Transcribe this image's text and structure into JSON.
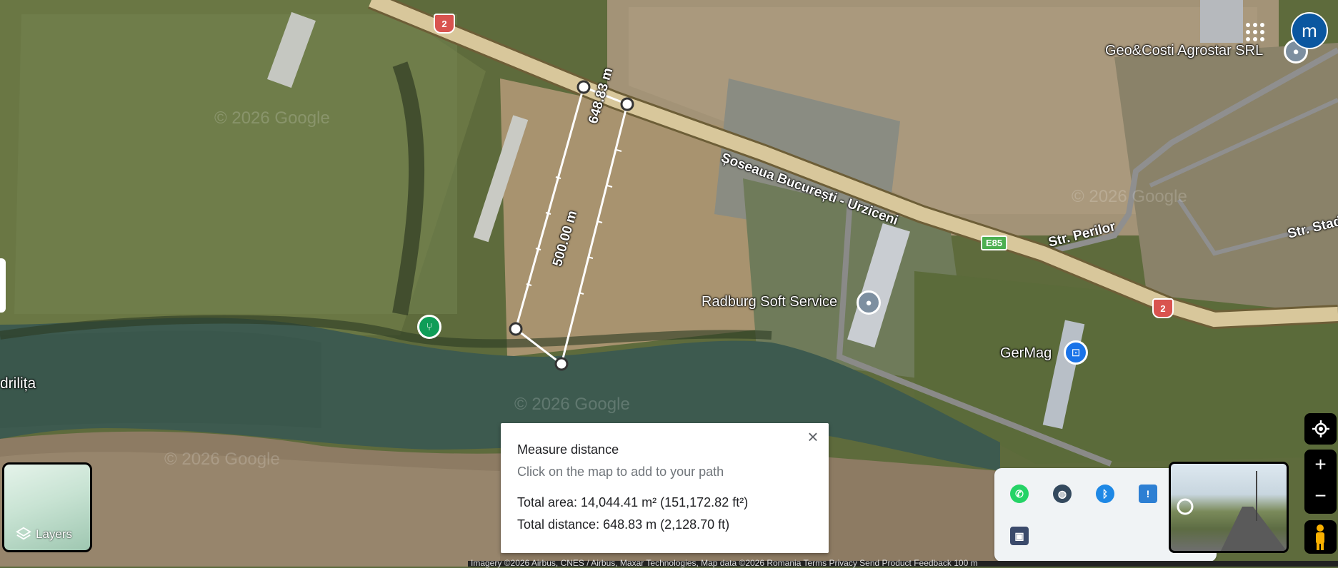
{
  "map": {
    "roads": {
      "main_road": "Șoseaua București - Urziceni",
      "perilor": "Str. Perilor",
      "stad": "Str. Stad",
      "route_shield": "2",
      "e_route": "E85"
    },
    "places": {
      "geocosti": "Geo&Costi Agrostar SRL",
      "radburg": "Radburg Soft Service",
      "germag": "GerMag",
      "lake": "drilița"
    },
    "watermarks": [
      "© 2026 Google",
      "© 2026 Google",
      "© 2026 Google",
      "© 2026 Google"
    ],
    "measure_labels": {
      "segment_top": "648.83 m",
      "segment_side": "500.00 m"
    }
  },
  "measure_panel": {
    "title": "Measure distance",
    "hint": "Click on the map to add to your path",
    "total_area": "Total area: 14,044.41 m² (151,172.82 ft²)",
    "total_distance": "Total distance: 648.83 m (2,128.70 ft)",
    "close_icon": "close-icon"
  },
  "layers": {
    "label": "Layers",
    "icon": "layers-icon"
  },
  "controls": {
    "my_location_icon": "my-location-icon",
    "zoom_in": "+",
    "zoom_out": "−",
    "pegman_icon": "pegman-icon"
  },
  "top_right": {
    "apps_icon": "apps-grid-icon",
    "avatar_letter": "m"
  },
  "extensions": [
    {
      "name": "whatsapp-icon",
      "color": "#25d366"
    },
    {
      "name": "globe-icon",
      "color": "#34495e"
    },
    {
      "name": "bluetooth-icon",
      "color": "#1e88e5"
    },
    {
      "name": "shield-warning-icon",
      "color": "#2d7fd3"
    },
    {
      "name": "utorrent-icon",
      "color": "#4caf50"
    },
    {
      "name": "computer-icon",
      "color": "#3b4a6b"
    }
  ],
  "footer": {
    "text": "Imagery ©2026 Airbus, CNES / Airbus, Maxar Technologies, Map data ©2026     Romania     Terms     Privacy     Send Product Feedback     100 m"
  }
}
